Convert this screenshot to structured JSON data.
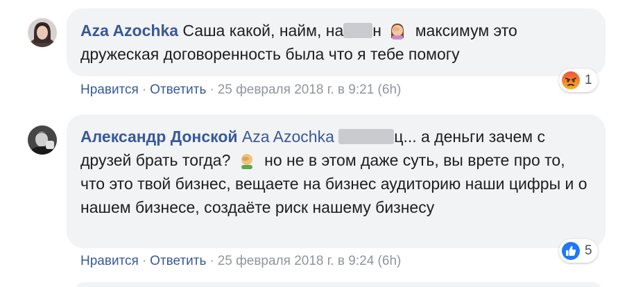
{
  "comments": [
    {
      "author": "Aza Azochka",
      "text_part1": "Саша какой, найм, на",
      "text_part2": "н",
      "text_part3": "максимум это дружеская договоренность была что я тебе помогу",
      "emoji": "facepalm-woman-emoji",
      "actions": {
        "like": "Нравится",
        "reply": "Ответить",
        "timestamp": "25 февраля 2018 г. в 9:21 (6h)"
      },
      "reaction": {
        "icon": "angry-reaction-icon",
        "count": "1",
        "color": "#e9710f"
      }
    },
    {
      "author": "Александр Донской",
      "mention": "Aza Azochka",
      "text_part1": "ц... а деньги зачем с друзей брать тогда?",
      "text_part2": "но не в этом даже суть, вы врете про то, что это твой бизнес, вещаете на бизнес аудиторию наши цифры и о нашем бизнесе, создаёте риск нашему бизнесу",
      "emoji": "facepalm-man-emoji",
      "actions": {
        "like": "Нравится",
        "reply": "Ответить",
        "timestamp": "25 февраля 2018 г. в 9:24 (6h)"
      },
      "reaction": {
        "icon": "like-reaction-icon",
        "count": "5",
        "color": "#2078f4"
      }
    }
  ],
  "separator": "·"
}
